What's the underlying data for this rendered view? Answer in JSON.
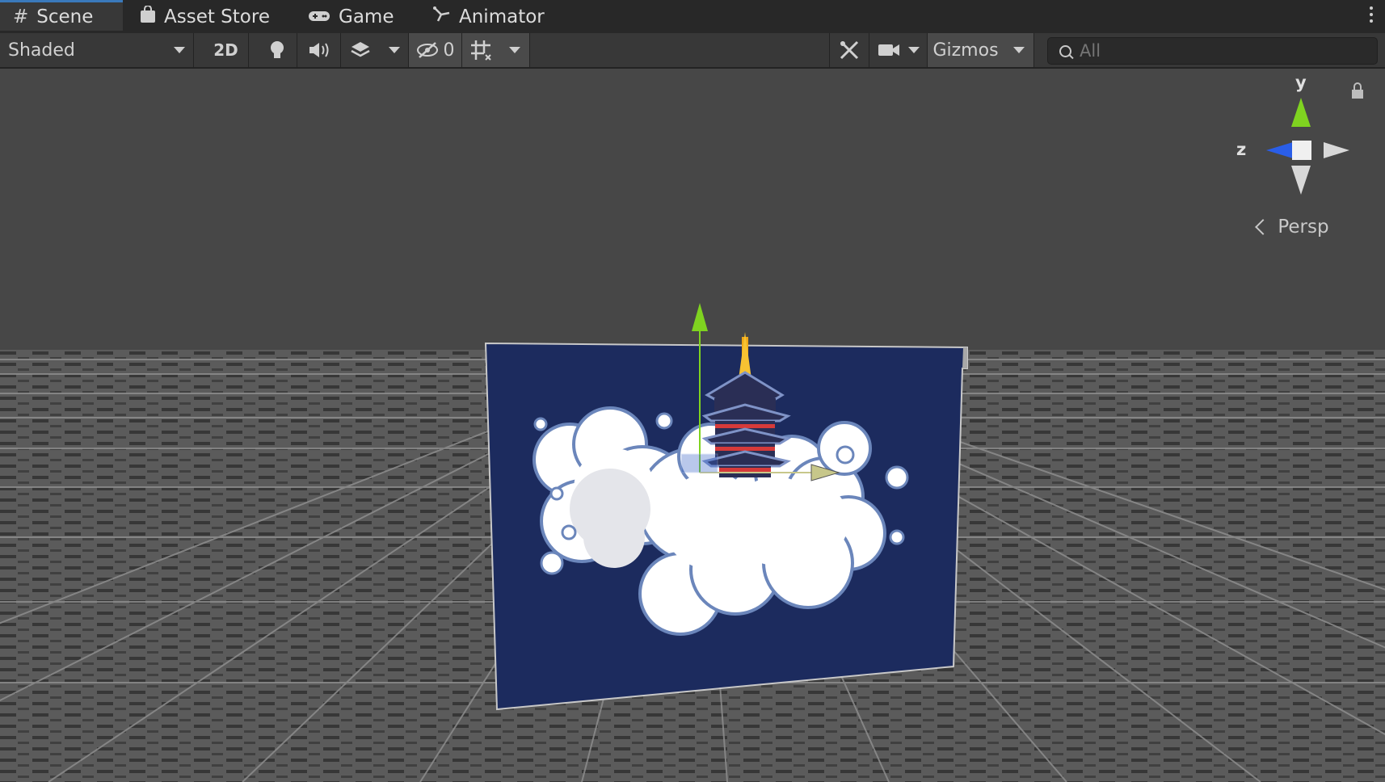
{
  "tabs": [
    {
      "label": "Scene",
      "icon": "grid-icon",
      "active": true
    },
    {
      "label": "Asset Store",
      "icon": "shopping-bag-icon",
      "active": false
    },
    {
      "label": "Game",
      "icon": "gamepad-icon",
      "active": false
    },
    {
      "label": "Animator",
      "icon": "animator-icon",
      "active": false
    }
  ],
  "toolbar": {
    "draw_mode": "Shaded",
    "mode_2d": "2D",
    "hidden_count": "0",
    "gizmos": "Gizmos",
    "search_placeholder": "All"
  },
  "orientation_gizmo": {
    "y_label": "y",
    "z_label": "z",
    "projection": "Persp"
  },
  "colors": {
    "accent": "#3a79bb",
    "sky": "#474747",
    "ground": "#5a5a5a",
    "grid_line": "#8c8c8c",
    "card": "#1c2b5e",
    "axis_y": "#7fd320",
    "axis_z": "#2a5ee8",
    "axis_x": "#c7c78a"
  }
}
